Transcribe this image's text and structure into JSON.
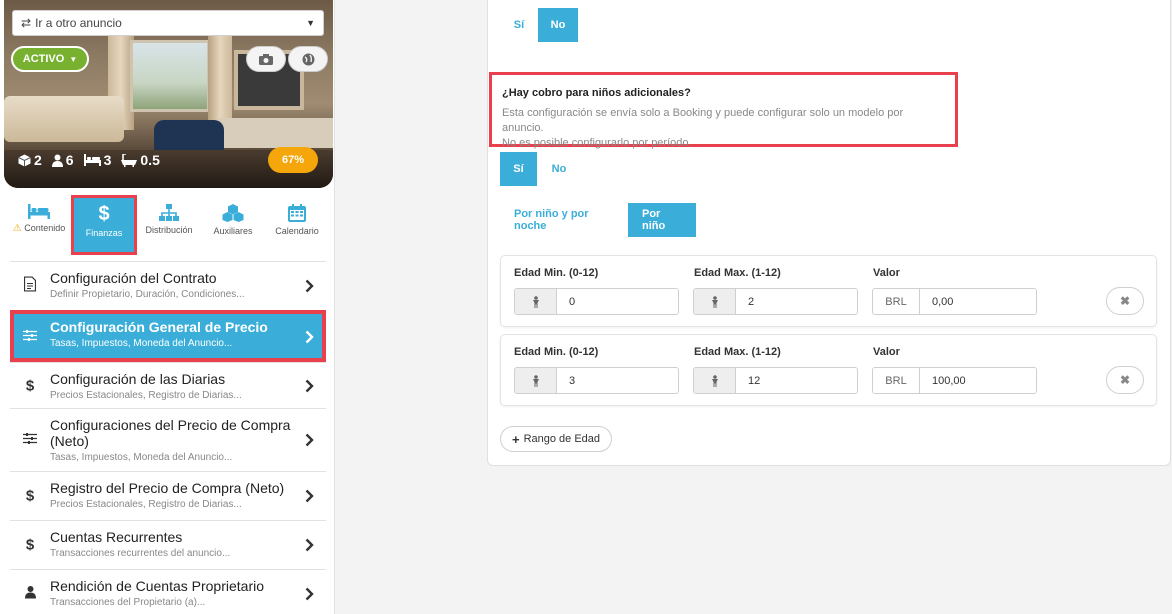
{
  "sidebar": {
    "goto_select": {
      "label": "Ir a otro anuncio"
    },
    "status_button": {
      "label": "ACTIVO"
    },
    "stats": {
      "units": "2",
      "guests": "6",
      "beds": "3",
      "baths": "0.5"
    },
    "completion": "67%",
    "tabs": [
      {
        "label": "Contenido",
        "icon": "bed-icon",
        "warning": true
      },
      {
        "label": "Finanzas",
        "icon": "dollar-icon",
        "active": true
      },
      {
        "label": "Distribución",
        "icon": "sitemap-icon"
      },
      {
        "label": "Auxiliares",
        "icon": "cubes-icon"
      },
      {
        "label": "Calendario",
        "icon": "calendar-icon"
      }
    ],
    "menu": [
      {
        "title": "Configuración del Contrato",
        "subtitle": "Definir Propietario, Duración, Condiciones...",
        "icon": "document-icon"
      },
      {
        "title": "Configuración General de Precio",
        "subtitle": "Tasas, Impuestos, Moneda del Anuncio...",
        "icon": "sliders-icon",
        "active": true
      },
      {
        "title": "Configuración de las Diarias",
        "subtitle": "Precios Estacionales, Registro de Diarias...",
        "icon": "dollar-icon"
      },
      {
        "title": "Configuraciones del Precio de Compra (Neto)",
        "subtitle": "Tasas, Impuestos, Moneda del Anuncio...",
        "icon": "sliders-icon"
      },
      {
        "title": "Registro del Precio de Compra (Neto)",
        "subtitle": "Precios Estacionales, Registro de Diarias...",
        "icon": "dollar-icon"
      },
      {
        "title": "Cuentas Recurrentes",
        "subtitle": "Transacciones recurrentes del anuncio...",
        "icon": "dollar-icon"
      },
      {
        "title": "Rendición de Cuentas Proprietario",
        "subtitle": "Transacciones del Propietario (a)...",
        "icon": "user-icon"
      }
    ]
  },
  "main": {
    "top_toggle": {
      "yes": "Sí",
      "no": "No",
      "selected": "No"
    },
    "children_question": {
      "title": "¿Hay cobro para niños adicionales?",
      "line1": "Esta configuración se envía solo a Booking y puede configurar solo un modelo por anuncio.",
      "line2": "No es posible configurarlo por período."
    },
    "children_toggle": {
      "yes": "Sí",
      "no": "No",
      "selected": "Sí"
    },
    "mode_toggle": {
      "per_night": "Por niño y por noche",
      "per_child": "Por niño",
      "selected": "Por niño"
    },
    "age_ranges": [
      {
        "min_label": "Edad Min. (0-12)",
        "min": "0",
        "max_label": "Edad Max. (1-12)",
        "max": "2",
        "value_label": "Valor",
        "currency": "BRL",
        "value": "0,00"
      },
      {
        "min_label": "Edad Min. (0-12)",
        "min": "3",
        "max_label": "Edad Max. (1-12)",
        "max": "12",
        "value_label": "Valor",
        "currency": "BRL",
        "value": "100,00"
      }
    ],
    "add_range_label": "Rango de Edad"
  },
  "colors": {
    "accent": "#3aaed8",
    "active_green": "#77b12f",
    "badge_orange": "#f4a60a",
    "highlight_red": "#e8414d"
  }
}
